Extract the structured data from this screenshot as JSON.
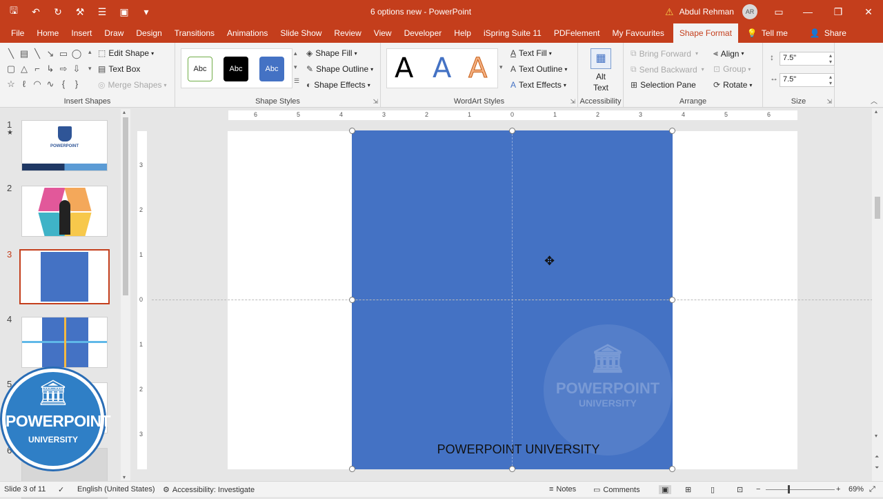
{
  "titlebar": {
    "document_title": "6 options new - PowerPoint",
    "user_name": "Abdul Rehman",
    "user_initials": "AR",
    "accent_color": "#c43e1c"
  },
  "tabs": [
    "File",
    "Home",
    "Insert",
    "Draw",
    "Design",
    "Transitions",
    "Animations",
    "Slide Show",
    "Review",
    "View",
    "Developer",
    "Help",
    "iSpring Suite 11",
    "PDFelement",
    "My Favourites"
  ],
  "active_tab": "Shape Format",
  "tell_me": "Tell me",
  "share": "Share",
  "ribbon": {
    "insert_shapes": {
      "label": "Insert Shapes",
      "edit_shape": "Edit Shape",
      "text_box": "Text Box",
      "merge_shapes": "Merge Shapes"
    },
    "shape_styles": {
      "label": "Shape Styles",
      "style_samples": [
        "Abc",
        "Abc",
        "Abc"
      ],
      "shape_fill": "Shape Fill",
      "shape_outline": "Shape Outline",
      "shape_effects": "Shape Effects"
    },
    "wordart_styles": {
      "label": "WordArt Styles",
      "samples": [
        "A",
        "A",
        "A"
      ],
      "text_fill": "Text Fill",
      "text_outline": "Text Outline",
      "text_effects": "Text Effects"
    },
    "accessibility": {
      "label": "Accessibility",
      "alt_text_line1": "Alt",
      "alt_text_line2": "Text"
    },
    "arrange": {
      "label": "Arrange",
      "bring_forward": "Bring Forward",
      "send_backward": "Send Backward",
      "selection_pane": "Selection Pane",
      "align": "Align",
      "group": "Group",
      "rotate": "Rotate"
    },
    "size": {
      "label": "Size",
      "height": "7.5\"",
      "width": "7.5\""
    }
  },
  "slides": [
    {
      "number": "1",
      "marker": "★"
    },
    {
      "number": "2",
      "marker": ""
    },
    {
      "number": "3",
      "marker": ""
    },
    {
      "number": "4",
      "marker": ""
    },
    {
      "number": "5",
      "marker": ""
    },
    {
      "number": "6",
      "marker": ""
    }
  ],
  "thumb1_text": "POWERPOINT",
  "ruler": {
    "horizontal": [
      "6",
      "5",
      "4",
      "3",
      "2",
      "1",
      "0",
      "1",
      "2",
      "3",
      "4",
      "5",
      "6"
    ],
    "vertical": [
      "3",
      "2",
      "1",
      "0",
      "1",
      "2",
      "3"
    ]
  },
  "canvas": {
    "shape_text": "POWERPOINT UNIVERSITY",
    "shape_color": "#4472c4",
    "watermark_line1": "POWERPOINT",
    "watermark_line2": "UNIVERSITY"
  },
  "logo": {
    "line1": "POWERPOINT",
    "line2": "UNIVERSITY"
  },
  "statusbar": {
    "slide_info": "Slide 3 of 11",
    "language": "English (United States)",
    "accessibility": "Accessibility: Investigate",
    "notes": "Notes",
    "comments": "Comments",
    "zoom": "69%"
  }
}
